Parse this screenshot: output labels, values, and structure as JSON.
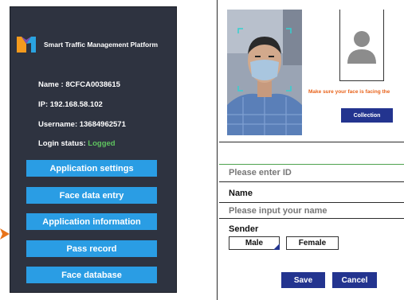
{
  "left": {
    "app_title": "Smart Traffic Management Platform",
    "name_line": "Name : 8CFCA0038615",
    "ip_line": "IP: 192.168.58.102",
    "username_line": "Username: 13684962571",
    "login_status_label": "Login status:",
    "login_status_value": "Logged",
    "menu": {
      "application_settings": "Application settings",
      "face_data_entry": "Face data entry",
      "application_information": "Application information",
      "pass_record": "Pass record",
      "face_database": "Face database"
    }
  },
  "right": {
    "hint": "Make sure your face is facing the",
    "collection_label": "Collection",
    "id_placeholder": "Please enter ID",
    "name_label": "Name",
    "name_placeholder": "Please input your name",
    "sender_label": "Sender",
    "male_label": "Male",
    "female_label": "Female",
    "save_label": "Save",
    "cancel_label": "Cancel"
  },
  "colors": {
    "panel_bg": "#2e3340",
    "menu_blue": "#2a9de4",
    "navy": "#23348f",
    "status_green": "#5fc45f",
    "hint_orange": "#e8621a"
  }
}
